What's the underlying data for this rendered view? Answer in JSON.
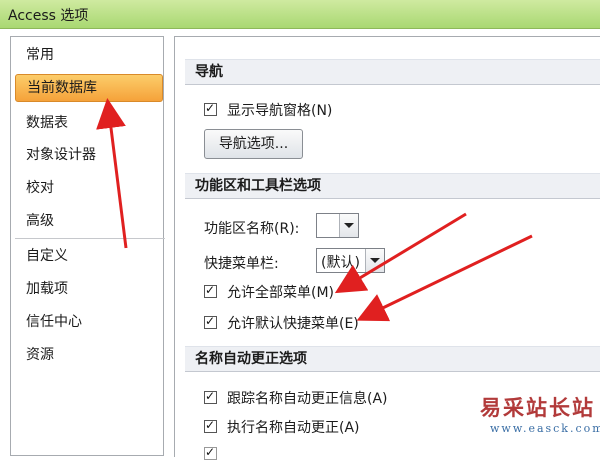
{
  "window": {
    "title": "Access 选项"
  },
  "sidebar": {
    "items": [
      {
        "label": "常用"
      },
      {
        "label": "当前数据库"
      },
      {
        "label": "数据表"
      },
      {
        "label": "对象设计器"
      },
      {
        "label": "校对"
      },
      {
        "label": "高级"
      },
      {
        "label": "自定义"
      },
      {
        "label": "加载项"
      },
      {
        "label": "信任中心"
      },
      {
        "label": "资源"
      }
    ],
    "selected": "当前数据库"
  },
  "navigation_section": {
    "title": "导航",
    "show_nav_pane_label": "显示导航窗格(N)",
    "show_nav_pane_checked": true,
    "nav_options_button": "导航选项..."
  },
  "ribbon_section": {
    "title": "功能区和工具栏选项",
    "ribbon_name_label": "功能区名称(R):",
    "ribbon_name_value": "",
    "shortcut_menu_label": "快捷菜单栏:",
    "shortcut_menu_value": "(默认)",
    "allow_full_menus_label": "允许全部菜单(M)",
    "allow_full_menus_checked": true,
    "allow_default_shortcut_label": "允许默认快捷菜单(E)",
    "allow_default_shortcut_checked": true
  },
  "autocorrect_section": {
    "title": "名称自动更正选项",
    "track_label": "跟踪名称自动更正信息(A)",
    "track_checked": true,
    "perform_label": "执行名称自动更正(A)",
    "perform_checked": true
  },
  "watermark": {
    "text": "易采站长站",
    "url": "www.easck.com"
  },
  "colors": {
    "accent": "#f5a23a",
    "titlebar": "#b7df84",
    "arrow": "#e02020"
  }
}
